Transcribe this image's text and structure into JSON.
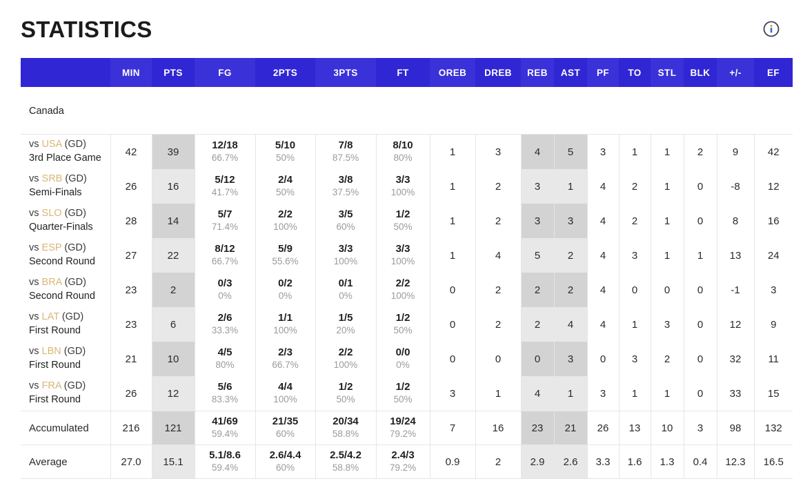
{
  "header": {
    "title": "STATISTICS",
    "info_icon": "info-circle-icon"
  },
  "table": {
    "columns": [
      {
        "key": "game",
        "label": ""
      },
      {
        "key": "min",
        "label": "MIN"
      },
      {
        "key": "pts",
        "label": "PTS"
      },
      {
        "key": "fg",
        "label": "FG"
      },
      {
        "key": "2pts",
        "label": "2PTS"
      },
      {
        "key": "3pts",
        "label": "3PTS"
      },
      {
        "key": "ft",
        "label": "FT"
      },
      {
        "key": "oreb",
        "label": "OREB"
      },
      {
        "key": "dreb",
        "label": "DREB"
      },
      {
        "key": "reb",
        "label": "REB"
      },
      {
        "key": "ast",
        "label": "AST"
      },
      {
        "key": "pf",
        "label": "PF"
      },
      {
        "key": "to",
        "label": "TO"
      },
      {
        "key": "stl",
        "label": "STL"
      },
      {
        "key": "blk",
        "label": "BLK"
      },
      {
        "key": "plusminus",
        "label": "+/-"
      },
      {
        "key": "ef",
        "label": "EF"
      }
    ],
    "team_name": "Canada",
    "rows": [
      {
        "vs": "vs",
        "opponent": "USA",
        "gd": "(GD)",
        "stage": "3rd Place Game",
        "min": "42",
        "pts": "39",
        "fg": "12/18",
        "fg_pct": "66.7%",
        "p2": "5/10",
        "p2_pct": "50%",
        "p3": "7/8",
        "p3_pct": "87.5%",
        "ft": "8/10",
        "ft_pct": "80%",
        "oreb": "1",
        "dreb": "3",
        "reb": "4",
        "ast": "5",
        "pf": "3",
        "to": "1",
        "stl": "1",
        "blk": "2",
        "plusminus": "9",
        "ef": "42"
      },
      {
        "vs": "vs",
        "opponent": "SRB",
        "gd": "(GD)",
        "stage": "Semi-Finals",
        "min": "26",
        "pts": "16",
        "fg": "5/12",
        "fg_pct": "41.7%",
        "p2": "2/4",
        "p2_pct": "50%",
        "p3": "3/8",
        "p3_pct": "37.5%",
        "ft": "3/3",
        "ft_pct": "100%",
        "oreb": "1",
        "dreb": "2",
        "reb": "3",
        "ast": "1",
        "pf": "4",
        "to": "2",
        "stl": "1",
        "blk": "0",
        "plusminus": "-8",
        "ef": "12"
      },
      {
        "vs": "vs",
        "opponent": "SLO",
        "gd": "(GD)",
        "stage": "Quarter-Finals",
        "min": "28",
        "pts": "14",
        "fg": "5/7",
        "fg_pct": "71.4%",
        "p2": "2/2",
        "p2_pct": "100%",
        "p3": "3/5",
        "p3_pct": "60%",
        "ft": "1/2",
        "ft_pct": "50%",
        "oreb": "1",
        "dreb": "2",
        "reb": "3",
        "ast": "3",
        "pf": "4",
        "to": "2",
        "stl": "1",
        "blk": "0",
        "plusminus": "8",
        "ef": "16"
      },
      {
        "vs": "vs",
        "opponent": "ESP",
        "gd": "(GD)",
        "stage": "Second Round",
        "min": "27",
        "pts": "22",
        "fg": "8/12",
        "fg_pct": "66.7%",
        "p2": "5/9",
        "p2_pct": "55.6%",
        "p3": "3/3",
        "p3_pct": "100%",
        "ft": "3/3",
        "ft_pct": "100%",
        "oreb": "1",
        "dreb": "4",
        "reb": "5",
        "ast": "2",
        "pf": "4",
        "to": "3",
        "stl": "1",
        "blk": "1",
        "plusminus": "13",
        "ef": "24"
      },
      {
        "vs": "vs",
        "opponent": "BRA",
        "gd": "(GD)",
        "stage": "Second Round",
        "min": "23",
        "pts": "2",
        "fg": "0/3",
        "fg_pct": "0%",
        "p2": "0/2",
        "p2_pct": "0%",
        "p3": "0/1",
        "p3_pct": "0%",
        "ft": "2/2",
        "ft_pct": "100%",
        "oreb": "0",
        "dreb": "2",
        "reb": "2",
        "ast": "2",
        "pf": "4",
        "to": "0",
        "stl": "0",
        "blk": "0",
        "plusminus": "-1",
        "ef": "3"
      },
      {
        "vs": "vs",
        "opponent": "LAT",
        "gd": "(GD)",
        "stage": "First Round",
        "min": "23",
        "pts": "6",
        "fg": "2/6",
        "fg_pct": "33.3%",
        "p2": "1/1",
        "p2_pct": "100%",
        "p3": "1/5",
        "p3_pct": "20%",
        "ft": "1/2",
        "ft_pct": "50%",
        "oreb": "0",
        "dreb": "2",
        "reb": "2",
        "ast": "4",
        "pf": "4",
        "to": "1",
        "stl": "3",
        "blk": "0",
        "plusminus": "12",
        "ef": "9"
      },
      {
        "vs": "vs",
        "opponent": "LBN",
        "gd": "(GD)",
        "stage": "First Round",
        "min": "21",
        "pts": "10",
        "fg": "4/5",
        "fg_pct": "80%",
        "p2": "2/3",
        "p2_pct": "66.7%",
        "p3": "2/2",
        "p3_pct": "100%",
        "ft": "0/0",
        "ft_pct": "0%",
        "oreb": "0",
        "dreb": "0",
        "reb": "0",
        "ast": "3",
        "pf": "0",
        "to": "3",
        "stl": "2",
        "blk": "0",
        "plusminus": "32",
        "ef": "11"
      },
      {
        "vs": "vs",
        "opponent": "FRA",
        "gd": "(GD)",
        "stage": "First Round",
        "min": "26",
        "pts": "12",
        "fg": "5/6",
        "fg_pct": "83.3%",
        "p2": "4/4",
        "p2_pct": "100%",
        "p3": "1/2",
        "p3_pct": "50%",
        "ft": "1/2",
        "ft_pct": "50%",
        "oreb": "3",
        "dreb": "1",
        "reb": "4",
        "ast": "1",
        "pf": "3",
        "to": "1",
        "stl": "1",
        "blk": "0",
        "plusminus": "33",
        "ef": "15"
      }
    ],
    "summary": [
      {
        "label": "Accumulated",
        "min": "216",
        "pts": "121",
        "fg": "41/69",
        "fg_pct": "59.4%",
        "p2": "21/35",
        "p2_pct": "60%",
        "p3": "20/34",
        "p3_pct": "58.8%",
        "ft": "19/24",
        "ft_pct": "79.2%",
        "oreb": "7",
        "dreb": "16",
        "reb": "23",
        "ast": "21",
        "pf": "26",
        "to": "13",
        "stl": "10",
        "blk": "3",
        "plusminus": "98",
        "ef": "132"
      },
      {
        "label": "Average",
        "min": "27.0",
        "pts": "15.1",
        "fg": "5.1/8.6",
        "fg_pct": "59.4%",
        "p2": "2.6/4.4",
        "p2_pct": "60%",
        "p3": "2.5/4.2",
        "p3_pct": "58.8%",
        "ft": "2.4/3",
        "ft_pct": "79.2%",
        "oreb": "0.9",
        "dreb": "2",
        "reb": "2.9",
        "ast": "2.6",
        "pf": "3.3",
        "to": "1.6",
        "stl": "1.3",
        "blk": "0.4",
        "plusminus": "12.3",
        "ef": "16.5"
      }
    ]
  },
  "colors": {
    "header_blue": "#3026d4",
    "header_blue_alt": "#3a31d9",
    "opponent_link": "#d8b677",
    "shade_dark": "#d3d3d3",
    "shade_light": "#e8e8e8",
    "percent_text": "#9a9a9a"
  }
}
